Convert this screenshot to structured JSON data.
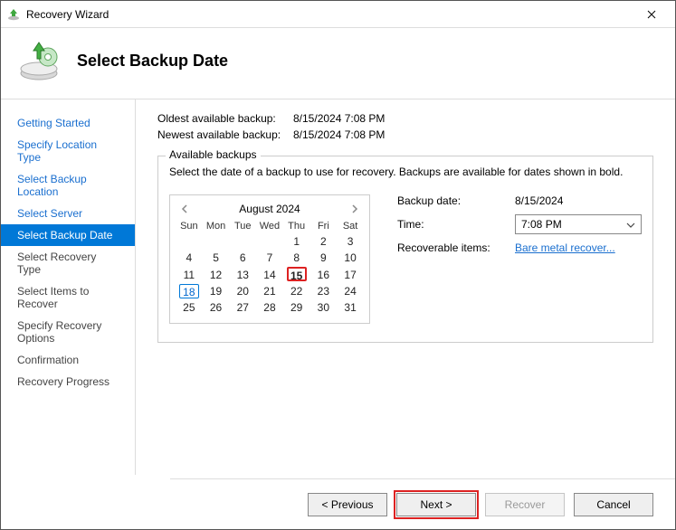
{
  "window": {
    "title": "Recovery Wizard"
  },
  "header": {
    "title": "Select Backup Date"
  },
  "sidebar": {
    "items": [
      {
        "label": "Getting Started"
      },
      {
        "label": "Specify Location Type"
      },
      {
        "label": "Select Backup Location"
      },
      {
        "label": "Select Server"
      },
      {
        "label": "Select Backup Date"
      },
      {
        "label": "Select Recovery Type"
      },
      {
        "label": "Select Items to Recover"
      },
      {
        "label": "Specify Recovery Options"
      },
      {
        "label": "Confirmation"
      },
      {
        "label": "Recovery Progress"
      }
    ],
    "active_index": 4
  },
  "summary": {
    "oldest_label": "Oldest available backup:",
    "oldest_value": "8/15/2024 7:08 PM",
    "newest_label": "Newest available backup:",
    "newest_value": "8/15/2024 7:08 PM"
  },
  "available": {
    "legend": "Available backups",
    "desc": "Select the date of a backup to use for recovery. Backups are available for dates shown in bold."
  },
  "calendar": {
    "title": "August 2024",
    "dow": [
      "Sun",
      "Mon",
      "Tue",
      "Wed",
      "Thu",
      "Fri",
      "Sat"
    ],
    "weeks": [
      [
        "",
        "",
        "",
        "",
        "1",
        "2",
        "3"
      ],
      [
        "4",
        "5",
        "6",
        "7",
        "8",
        "9",
        "10"
      ],
      [
        "11",
        "12",
        "13",
        "14",
        "15",
        "16",
        "17"
      ],
      [
        "18",
        "19",
        "20",
        "21",
        "22",
        "23",
        "24"
      ],
      [
        "25",
        "26",
        "27",
        "28",
        "29",
        "30",
        "31"
      ]
    ],
    "selected_day": "15",
    "today_day": "18"
  },
  "details": {
    "date_label": "Backup date:",
    "date_value": "8/15/2024",
    "time_label": "Time:",
    "time_value": "7:08 PM",
    "items_label": "Recoverable items:",
    "items_link": "Bare metal recover..."
  },
  "footer": {
    "previous": "< Previous",
    "next": "Next >",
    "recover": "Recover",
    "cancel": "Cancel"
  }
}
